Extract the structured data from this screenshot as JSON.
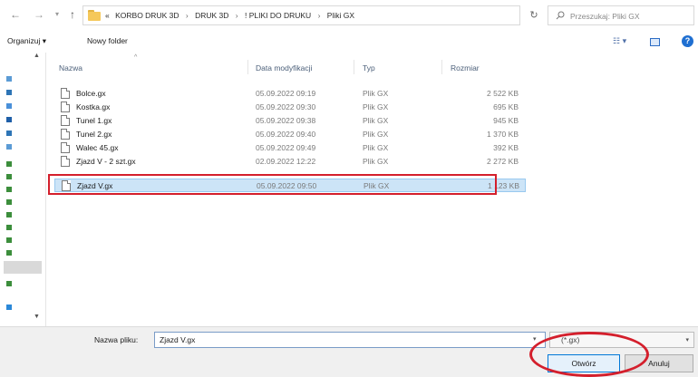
{
  "address_bar": {
    "prefix": "«",
    "breadcrumbs": [
      "KORBO DRUK 3D",
      "DRUK 3D",
      "! PLIKI DO DRUKU",
      "Pliki GX"
    ],
    "separator": "›",
    "search_placeholder": "Przeszukaj: Pliki GX"
  },
  "nav": {
    "back": "←",
    "forward": "→",
    "history": "▾",
    "up": "↑",
    "dropdown": "⌄",
    "refresh": "↻"
  },
  "toolbar": {
    "organize_label": "Organizuj ▾",
    "new_folder_label": "Nowy folder",
    "view_icon": "☷ ▾",
    "help": "?"
  },
  "columns": {
    "name": "Nazwa",
    "date": "Data modyfikacji",
    "type": "Typ",
    "size": "Rozmiar"
  },
  "files": [
    {
      "name": "Bolce.gx",
      "date": "05.09.2022 09:19",
      "type": "Plik GX",
      "size": "2 522 KB"
    },
    {
      "name": "Kostka.gx",
      "date": "05.09.2022 09:30",
      "type": "Plik GX",
      "size": "695 KB"
    },
    {
      "name": "Tunel 1.gx",
      "date": "05.09.2022 09:38",
      "type": "Plik GX",
      "size": "945 KB"
    },
    {
      "name": "Tunel 2.gx",
      "date": "05.09.2022 09:40",
      "type": "Plik GX",
      "size": "1 370 KB"
    },
    {
      "name": "Walec 45.gx",
      "date": "05.09.2022 09:49",
      "type": "Plik GX",
      "size": "392 KB"
    },
    {
      "name": "Zjazd V - 2 szt.gx",
      "date": "02.09.2022 12:22",
      "type": "Plik GX",
      "size": "2 272 KB"
    },
    {
      "name": "Zjazd V.gx",
      "date": "05.09.2022 09:50",
      "type": "Plik GX",
      "size": "1 123 KB"
    }
  ],
  "selected_file_index": 6,
  "bottom": {
    "filename_label": "Nazwa pliku:",
    "filename_value": "Zjazd V.gx",
    "filetype_value": "(*.gx)",
    "open_label": "Otwórz",
    "cancel_label": "Anuluj"
  },
  "colors": {
    "highlight": "#d41f2c",
    "selection": "#cce4f7",
    "accent": "#0078d7"
  }
}
